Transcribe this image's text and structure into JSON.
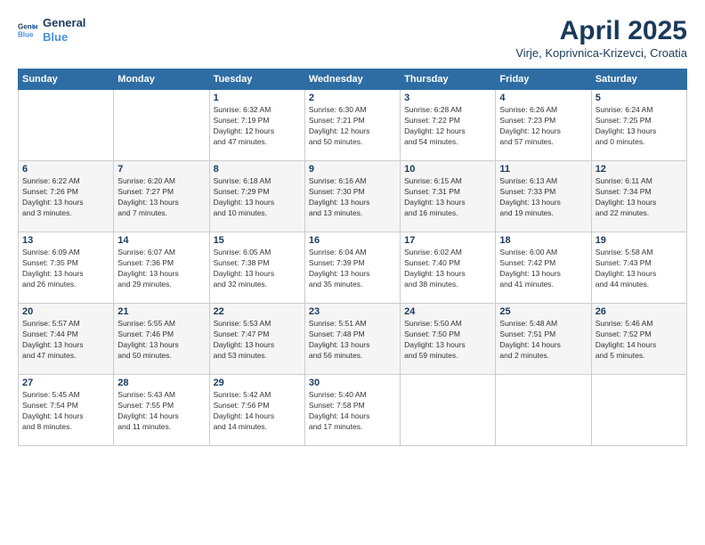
{
  "logo": {
    "line1": "General",
    "line2": "Blue"
  },
  "title": "April 2025",
  "subtitle": "Virje, Koprivnica-Krizevci, Croatia",
  "days_of_week": [
    "Sunday",
    "Monday",
    "Tuesday",
    "Wednesday",
    "Thursday",
    "Friday",
    "Saturday"
  ],
  "weeks": [
    [
      {
        "day": "",
        "info": ""
      },
      {
        "day": "",
        "info": ""
      },
      {
        "day": "1",
        "info": "Sunrise: 6:32 AM\nSunset: 7:19 PM\nDaylight: 12 hours\nand 47 minutes."
      },
      {
        "day": "2",
        "info": "Sunrise: 6:30 AM\nSunset: 7:21 PM\nDaylight: 12 hours\nand 50 minutes."
      },
      {
        "day": "3",
        "info": "Sunrise: 6:28 AM\nSunset: 7:22 PM\nDaylight: 12 hours\nand 54 minutes."
      },
      {
        "day": "4",
        "info": "Sunrise: 6:26 AM\nSunset: 7:23 PM\nDaylight: 12 hours\nand 57 minutes."
      },
      {
        "day": "5",
        "info": "Sunrise: 6:24 AM\nSunset: 7:25 PM\nDaylight: 13 hours\nand 0 minutes."
      }
    ],
    [
      {
        "day": "6",
        "info": "Sunrise: 6:22 AM\nSunset: 7:26 PM\nDaylight: 13 hours\nand 3 minutes."
      },
      {
        "day": "7",
        "info": "Sunrise: 6:20 AM\nSunset: 7:27 PM\nDaylight: 13 hours\nand 7 minutes."
      },
      {
        "day": "8",
        "info": "Sunrise: 6:18 AM\nSunset: 7:29 PM\nDaylight: 13 hours\nand 10 minutes."
      },
      {
        "day": "9",
        "info": "Sunrise: 6:16 AM\nSunset: 7:30 PM\nDaylight: 13 hours\nand 13 minutes."
      },
      {
        "day": "10",
        "info": "Sunrise: 6:15 AM\nSunset: 7:31 PM\nDaylight: 13 hours\nand 16 minutes."
      },
      {
        "day": "11",
        "info": "Sunrise: 6:13 AM\nSunset: 7:33 PM\nDaylight: 13 hours\nand 19 minutes."
      },
      {
        "day": "12",
        "info": "Sunrise: 6:11 AM\nSunset: 7:34 PM\nDaylight: 13 hours\nand 22 minutes."
      }
    ],
    [
      {
        "day": "13",
        "info": "Sunrise: 6:09 AM\nSunset: 7:35 PM\nDaylight: 13 hours\nand 26 minutes."
      },
      {
        "day": "14",
        "info": "Sunrise: 6:07 AM\nSunset: 7:36 PM\nDaylight: 13 hours\nand 29 minutes."
      },
      {
        "day": "15",
        "info": "Sunrise: 6:05 AM\nSunset: 7:38 PM\nDaylight: 13 hours\nand 32 minutes."
      },
      {
        "day": "16",
        "info": "Sunrise: 6:04 AM\nSunset: 7:39 PM\nDaylight: 13 hours\nand 35 minutes."
      },
      {
        "day": "17",
        "info": "Sunrise: 6:02 AM\nSunset: 7:40 PM\nDaylight: 13 hours\nand 38 minutes."
      },
      {
        "day": "18",
        "info": "Sunrise: 6:00 AM\nSunset: 7:42 PM\nDaylight: 13 hours\nand 41 minutes."
      },
      {
        "day": "19",
        "info": "Sunrise: 5:58 AM\nSunset: 7:43 PM\nDaylight: 13 hours\nand 44 minutes."
      }
    ],
    [
      {
        "day": "20",
        "info": "Sunrise: 5:57 AM\nSunset: 7:44 PM\nDaylight: 13 hours\nand 47 minutes."
      },
      {
        "day": "21",
        "info": "Sunrise: 5:55 AM\nSunset: 7:46 PM\nDaylight: 13 hours\nand 50 minutes."
      },
      {
        "day": "22",
        "info": "Sunrise: 5:53 AM\nSunset: 7:47 PM\nDaylight: 13 hours\nand 53 minutes."
      },
      {
        "day": "23",
        "info": "Sunrise: 5:51 AM\nSunset: 7:48 PM\nDaylight: 13 hours\nand 56 minutes."
      },
      {
        "day": "24",
        "info": "Sunrise: 5:50 AM\nSunset: 7:50 PM\nDaylight: 13 hours\nand 59 minutes."
      },
      {
        "day": "25",
        "info": "Sunrise: 5:48 AM\nSunset: 7:51 PM\nDaylight: 14 hours\nand 2 minutes."
      },
      {
        "day": "26",
        "info": "Sunrise: 5:46 AM\nSunset: 7:52 PM\nDaylight: 14 hours\nand 5 minutes."
      }
    ],
    [
      {
        "day": "27",
        "info": "Sunrise: 5:45 AM\nSunset: 7:54 PM\nDaylight: 14 hours\nand 8 minutes."
      },
      {
        "day": "28",
        "info": "Sunrise: 5:43 AM\nSunset: 7:55 PM\nDaylight: 14 hours\nand 11 minutes."
      },
      {
        "day": "29",
        "info": "Sunrise: 5:42 AM\nSunset: 7:56 PM\nDaylight: 14 hours\nand 14 minutes."
      },
      {
        "day": "30",
        "info": "Sunrise: 5:40 AM\nSunset: 7:58 PM\nDaylight: 14 hours\nand 17 minutes."
      },
      {
        "day": "",
        "info": ""
      },
      {
        "day": "",
        "info": ""
      },
      {
        "day": "",
        "info": ""
      }
    ]
  ]
}
